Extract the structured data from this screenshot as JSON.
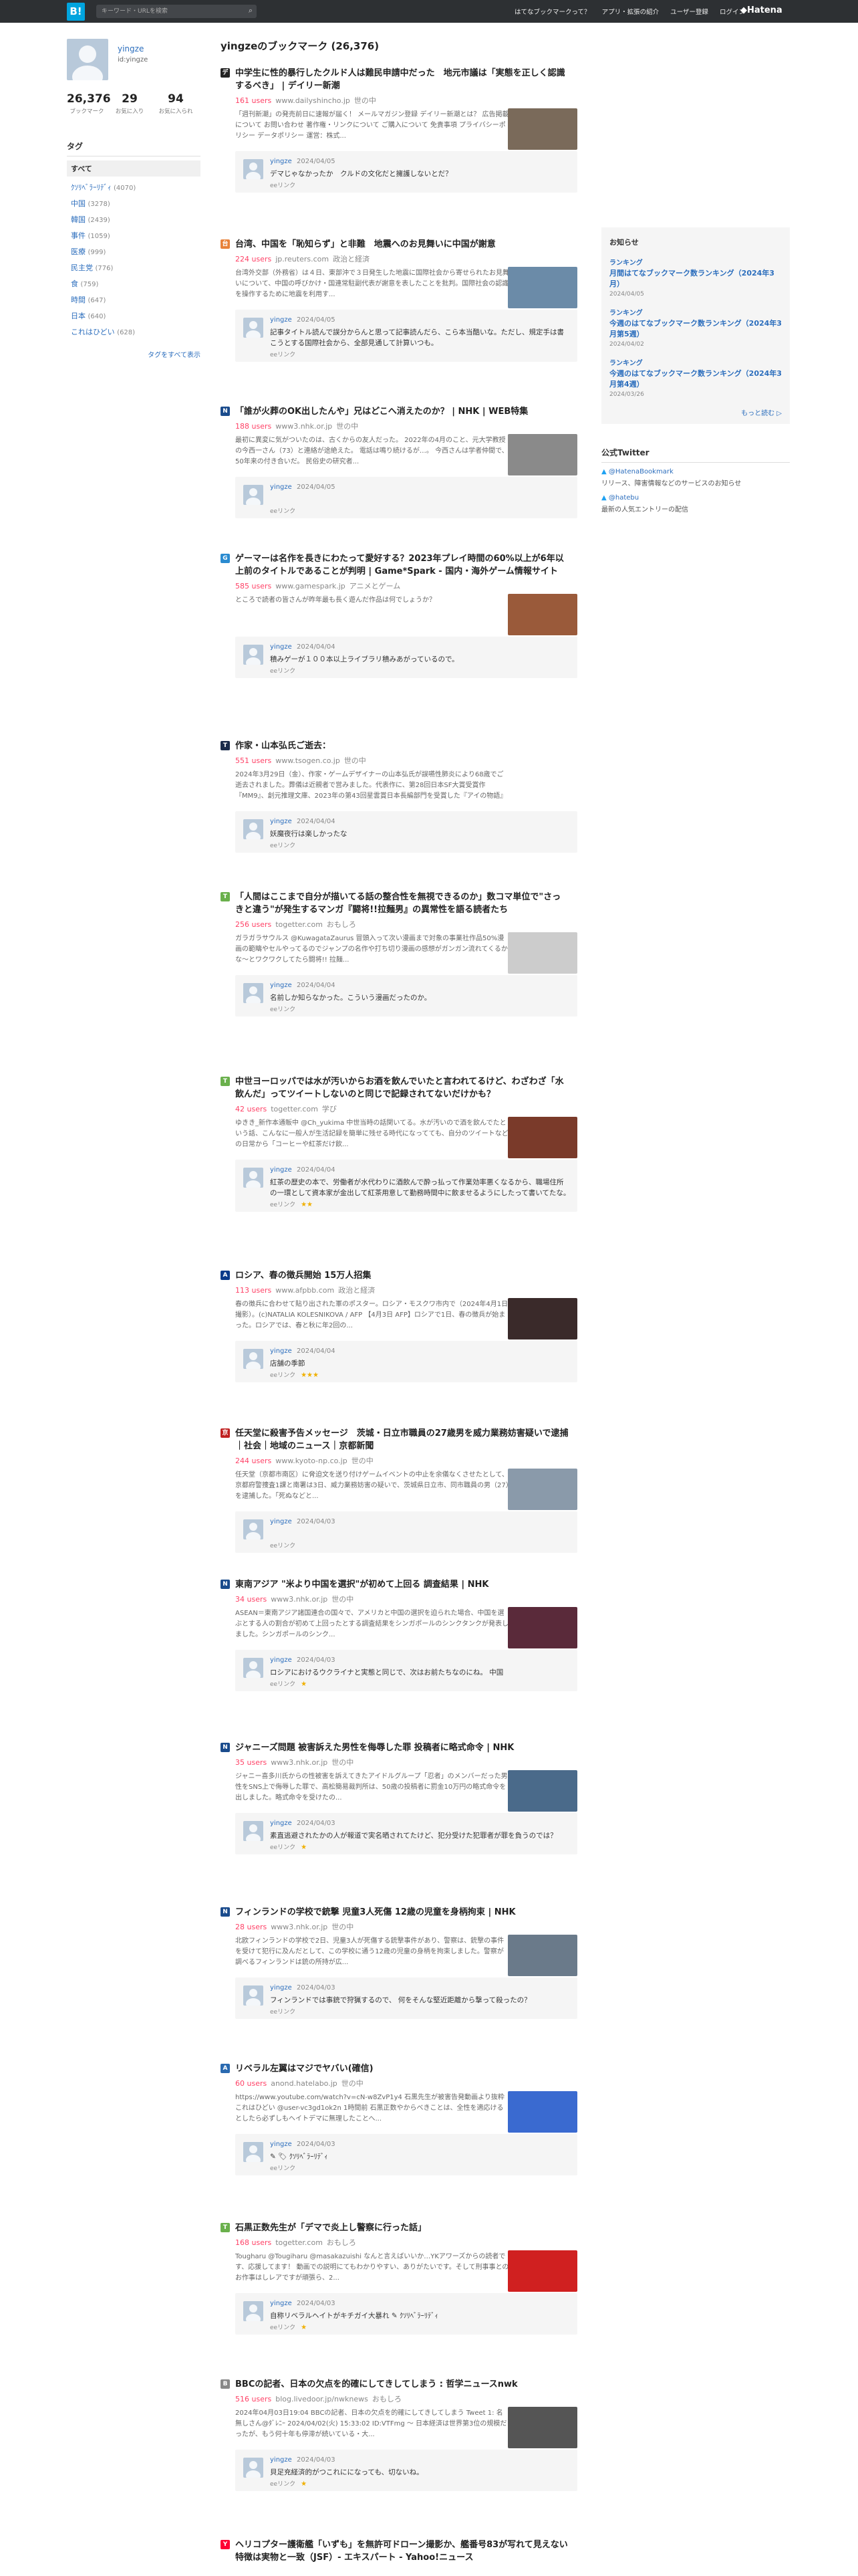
{
  "header": {
    "logo": "B!",
    "search_placeholder": "キーワード・URLを検索",
    "nav": [
      "はてなブックマークって？",
      "アプリ・拡張の紹介",
      "ユーザー登録",
      "ログイン"
    ],
    "brand": "◆Hatena"
  },
  "profile": {
    "name": "yingze",
    "id": "id:yingze",
    "stats": [
      {
        "n": "26,376",
        "l": "ブックマーク"
      },
      {
        "n": "29",
        "l": "お気に入り"
      },
      {
        "n": "94",
        "l": "お気に入られ"
      }
    ]
  },
  "tags": {
    "heading": "タグ",
    "all": "すべて",
    "items": [
      {
        "name": "ｸｿﾘﾍﾞﾗｰﾘﾃﾞｨ",
        "count": "(4070)"
      },
      {
        "name": "中国",
        "count": "(3278)"
      },
      {
        "name": "韓国",
        "count": "(2439)"
      },
      {
        "name": "事件",
        "count": "(1059)"
      },
      {
        "name": "医療",
        "count": "(999)"
      },
      {
        "name": "民主党",
        "count": "(776)"
      },
      {
        "name": "食",
        "count": "(759)"
      },
      {
        "name": "時間",
        "count": "(647)"
      },
      {
        "name": "日本",
        "count": "(640)"
      },
      {
        "name": "これはひどい",
        "count": "(628)"
      }
    ],
    "more": "タグをすべて表示"
  },
  "main": {
    "title": "yingzeのブックマーク (26,376)",
    "entries": [
      {
        "fav": "デ",
        "favcolor": "#222",
        "title": "中学生に性的暴行したクルド人は難民申請中だった　地元市議は「実態を正しく認識するべき」 | デイリー新潮",
        "users": "161 users",
        "domain": "www.dailyshincho.jp",
        "cat": "世の中",
        "body": "「週刊新潮」の発売前日に速報が届く！ メールマガジン登録 デイリー新潮とは？ 広告掲載について お問い合わせ 著作権・リンクについて ご購入について 免責事項 プライバシーポリシー データポリシー 運営：株式...",
        "user": "yingze",
        "date": "2024/04/05",
        "comment": "デマじゃなかったか　クルドの文化だと擁護しないとだ？",
        "foot": "eeリンク",
        "stars": "",
        "thumb": "#7a6a5a"
      },
      {
        "fav": "台",
        "favcolor": "#e8823a",
        "title": "台湾、中国を「恥知らず」と非難　地震へのお見舞いに中国が謝意",
        "users": "224 users",
        "domain": "jp.reuters.com",
        "cat": "政治と経済",
        "body": "台湾外交部（外務省）は４日、東部沖で３日発生した地震に国際社会から寄せられたお見舞いについて、中国の呼びかけ・国連常駐副代表が謝意を表したことを批判。国際社会の認識を操作するために地震を利用す...",
        "user": "yingze",
        "date": "2024/04/05",
        "comment": "記事タイトル読んで誤分からんと思って記事読んだら、こら本当酷いな。ただし、規定手は書こうとする国際社会から、全部見通して計算いつも。",
        "foot": "eeリンク",
        "stars": "",
        "thumb": "#6b8ba8"
      },
      {
        "fav": "N",
        "favcolor": "#1a4b8c",
        "title": "「誰が火葬のOK出したんや」兄はどこへ消えたのか？ | NHK | WEB特集",
        "users": "188 users",
        "domain": "www3.nhk.or.jp",
        "cat": "世の中",
        "body": "最初に異変に気がついたのは、古くからの友人だった。 2022年の4月のこと、元大学教授の今西一さん（73）と連絡が途絶えた。 電話は鳴り続けるが…。 今西さんは学者仲間で、50年来の付き合いだ。 民俗史の研究者...",
        "user": "yingze",
        "date": "2024/04/05",
        "comment": "",
        "foot": "eeリンク",
        "stars": "",
        "thumb": "#8a8a8a"
      },
      {
        "fav": "G",
        "favcolor": "#2a8bd0",
        "title": "ゲーマーは名作を長きにわたって愛好する？2023年プレイ時間の60%以上が6年以上前のタイトルであることが判明 | Game*Spark - 国内・海外ゲーム情報サイト",
        "users": "585 users",
        "domain": "www.gamespark.jp",
        "cat": "アニメとゲーム",
        "body": "ところで読者の皆さんが昨年最も長く遊んだ作品は何でしょうか？",
        "user": "yingze",
        "date": "2024/04/04",
        "comment": "積みゲーが１００本以上ライブラリ積みあがっているので。",
        "foot": "eeリンク",
        "stars": "",
        "thumb": "#9a5a3a"
      },
      {
        "fav": "T",
        "favcolor": "#1a2b4a",
        "title": "作家・山本弘氏ご逝去：",
        "users": "551 users",
        "domain": "www.tsogen.co.jp",
        "cat": "世の中",
        "body": "2024年3月29日（金）、作家・ゲームデザイナーの山本弘氏が誤嚥性肺炎により68歳でご逝去されました。葬儀は近親者で営みました。代表作に、第28回日本SF大賞受賞作『MM9』、創元推理文庫、2023年の第43回星雲賞日本長編部門を受賞した『アイの物語』のほか、『神は沈黙せず』、《MM9》《BISビブ...",
        "user": "yingze",
        "date": "2024/04/04",
        "comment": "妖魔夜行は楽しかったな",
        "foot": "eeリンク",
        "stars": "",
        "thumb": ""
      },
      {
        "fav": "T",
        "favcolor": "#6ab04c",
        "title": "「人間はここまで自分が描いてる話の整合性を無視できるのか」数コマ単位で\"さっきと違う\"が発生するマンガ『闘将!!拉麵男』の異常性を語る読者たち",
        "users": "256 users",
        "domain": "togetter.com",
        "cat": "おもしろ",
        "body": "ガラガラサウルス @KuwagataZaurus 冒頭入って次い漫画まで対象の事業社作品50%漫画の範疇やセルやってるのでジャンプの名作や打ち切り漫画の感想がガンガン流れてくるかな〜とワクワクしてたら闘将!! 拉麺...",
        "user": "yingze",
        "date": "2024/04/04",
        "comment": "名前しか知らなかった。こういう漫画だったのか。",
        "foot": "eeリンク",
        "stars": "",
        "thumb": "#ccc"
      },
      {
        "fav": "T",
        "favcolor": "#6ab04c",
        "title": "中世ヨーロッパでは水が汚いからお酒を飲んでいたと言われてるけど、わざわざ「水飲んだ」ってツイートしないのと同じで記録されてないだけかも？",
        "users": "42 users",
        "domain": "togetter.com",
        "cat": "学び",
        "body": "ゆきき_新作本通販中 @Ch_yukima 中世当時の話関いてる。水が汚いので酒を飲んでたという話、こんなに一般人が生活記録を簡単に残せる時代になってても、自分のツイートなどの日常から「コーヒーや紅茶だけ飲...",
        "user": "yingze",
        "date": "2024/04/04",
        "comment": "紅茶の歴史の本で、労働者が水代わりに酒飲んで酔っ払って作業効率悪くなるから、職場住所の一環として資本家が金出して紅茶用意して勤務時間中に飲ませるようにしたって書いてたな。",
        "foot": "eeリンク",
        "stars": "★★",
        "thumb": "#7a3a2a"
      },
      {
        "fav": "A",
        "favcolor": "#0a3a8a",
        "title": "ロシア、春の徴兵開始 15万人招集",
        "users": "113 users",
        "domain": "www.afpbb.com",
        "cat": "政治と経済",
        "body": "春の徴兵に合わせて貼り出された軍のポスター。ロシア・モスクワ市内で（2024年4月1日撮影）。(c)NATALIA KOLESNIKOVA / AFP 【4月3日 AFP】ロシアで1日、春の徴兵が始まった。ロシアでは、春と秋に年2回の...",
        "user": "yingze",
        "date": "2024/04/04",
        "comment": "店舗の季節",
        "foot": "eeリンク",
        "stars": "★★★",
        "thumb": "#3a2a2a"
      },
      {
        "fav": "京",
        "favcolor": "#c02020",
        "title": "任天堂に殺害予告メッセージ　茨城・日立市職員の27歳男を威力業務妨害疑いで逮捕｜社会｜地域のニュース｜京都新聞",
        "users": "244 users",
        "domain": "www.kyoto-np.co.jp",
        "cat": "世の中",
        "body": "任天堂（京都市南区）に脅迫文を送り付けゲームイベントの中止を余儀なくさせたとして、京都府警捜査1課と南署は3日、威力業務妨害の疑いで、茨城県日立市、同市職員の男（27）を逮捕した。「死ぬなどと...",
        "user": "yingze",
        "date": "2024/04/03",
        "comment": "",
        "foot": "eeリンク",
        "stars": "",
        "thumb": "#8a9aaa"
      },
      {
        "fav": "N",
        "favcolor": "#1a4b8c",
        "title": "東南アジア \"米より中国を選択\"が初めて上回る 調査結果 | NHK",
        "users": "34 users",
        "domain": "www3.nhk.or.jp",
        "cat": "世の中",
        "body": "ASEAN＝東南アジア諸国連合の国々で、アメリカと中国の選択を迫られた場合、中国を選ぶとする人の割合が初めて上回ったとする調査結果をシンガポールのシンクタンクが発表しました。シンガポールのシンク...",
        "user": "yingze",
        "date": "2024/04/03",
        "comment": "ロシアにおけるウクライナと実態と同じで、次はお前たちなのにね。 中国",
        "foot": "eeリンク",
        "stars": "★",
        "thumb": "#5a2a3a"
      },
      {
        "fav": "N",
        "favcolor": "#1a4b8c",
        "title": "ジャニーズ問題 被害訴えた男性を侮辱した罪 投稿者に略式命令 | NHK",
        "users": "35 users",
        "domain": "www3.nhk.or.jp",
        "cat": "世の中",
        "body": "ジャニー喜多川氏からの性被害を訴えてきたアイドルグループ「忍者」のメンバーだった男性をSNS上で侮辱した罪で、高松簡易裁判所は、50歳の投稿者に罰金10万円の略式命令を出しました。略式命令を受けたの...",
        "user": "yingze",
        "date": "2024/04/03",
        "comment": "素直逃避されたかの人が報道で実名晒されてたけど、犯分受けた犯罪者が罪を負うのでは？",
        "foot": "eeリンク",
        "stars": "★",
        "thumb": "#4a6a8a"
      },
      {
        "fav": "N",
        "favcolor": "#1a4b8c",
        "title": "フィンランドの学校で銃撃 児童3人死傷 12歳の児童を身柄拘束 | NHK",
        "users": "28 users",
        "domain": "www3.nhk.or.jp",
        "cat": "世の中",
        "body": "北欧フィンランドの学校で2日、児童3人が死傷する銃撃事件があり、警察は、銃撃の事件を受けて犯行に及んだとして、この学校に通う12歳の児童の身柄を拘束しました。警察が調べるフィンランドは銃の所持が広...",
        "user": "yingze",
        "date": "2024/04/03",
        "comment": "フィンランドでは事銃で狩猟するので、 何をそんな堅近距離から撃って殺ったの？",
        "foot": "eeリンク",
        "stars": "",
        "thumb": "#6a7a8a"
      },
      {
        "fav": "A",
        "favcolor": "#2a6ab0",
        "title": "リベラル左翼はマジでヤバい(確信)",
        "users": "60 users",
        "domain": "anond.hatelabo.jp",
        "cat": "世の中",
        "body": "https://www.youtube.com/watch?v=cN-w8ZvP1y4 石黒先生が被害告発動画より抜粋 これはひどい @user-vc3gd1ok2n 1時間前 石黒正数やからべきことは、全性を適応けるとしたら必ずしもヘイトデマに無理したことへ...",
        "user": "yingze",
        "date": "2024/04/03",
        "comment": "✎ 🏷 ｸｿﾘﾍﾞﾗｰﾘﾃﾞｨ",
        "foot": "eeリンク",
        "stars": "",
        "thumb": "#3a6ad0"
      },
      {
        "fav": "T",
        "favcolor": "#6ab04c",
        "title": "石黒正数先生が「デマで炎上し警察に行った話」",
        "users": "168 users",
        "domain": "togetter.com",
        "cat": "おもしろ",
        "body": "Tougharu @Tougiharu @masakazuishi なんと言えばいいか…YKアワーズからの読者です、応援してます！ 動画での説明にてもわかりやすい、ありがたいです。そして刑事事とのお作事はしレアですが頑張ら、2...",
        "user": "yingze",
        "date": "2024/04/03",
        "comment": "自称リベラルヘイトがキチガイ大暴れ ✎ ｸｿﾘﾍﾞﾗｰﾘﾃﾞｨ",
        "foot": "eeリンク",
        "stars": "★",
        "thumb": "#d02020"
      },
      {
        "fav": "B",
        "favcolor": "#888",
        "title": "BBCの記者、日本の欠点を的確にしてきしてしまう : 哲学ニュースnwk",
        "users": "516 users",
        "domain": "blog.livedoor.jp/nwknews",
        "cat": "おもしろ",
        "body": "2024年04月03日19:04 BBCの記者、日本の欠点を的確にしてきしてしまう Tweet 1: 名無しさん@ﾀﾞﾚﾆｰ 2024/04/02(火) 15:33:02 ID:VTFmg ～ 日本経済は世界第3位の規模だったが、もう何十年も停滞が続いている・大...",
        "user": "yingze",
        "date": "2024/04/03",
        "comment": "貝足充経済的がつこれにになっても、切ないね。",
        "foot": "eeリンク",
        "stars": "★",
        "thumb": "#555"
      },
      {
        "fav": "Y",
        "favcolor": "#ff0033",
        "title": "ヘリコプター護衛艦「いずも」を無許可ドローン撮影か、艦番号83が写れて見えない特徴は実物と一致（JSF）- エキスパート - Yahoo!ニュース",
        "users": "",
        "domain": "",
        "cat": "",
        "body": "",
        "user": "",
        "date": "",
        "comment": "",
        "foot": "",
        "stars": "",
        "thumb": ""
      }
    ]
  },
  "side": {
    "notice_heading": "お知らせ",
    "notices": [
      {
        "cat": "ランキング",
        "title": "月間はてなブックマーク数ランキング（2024年3月）",
        "date": "2024/04/05"
      },
      {
        "cat": "ランキング",
        "title": "今週のはてなブックマーク数ランキング（2024年3月第5週）",
        "date": "2024/04/02"
      },
      {
        "cat": "ランキング",
        "title": "今週のはてなブックマーク数ランキング（2024年3月第4週）",
        "date": "2024/03/26"
      }
    ],
    "notice_more": "もっと読む ▷",
    "twitter_heading": "公式Twitter",
    "twitter": [
      {
        "account": "@HatenaBookmark",
        "desc": "リリース、障害情報などのサービスのお知らせ"
      },
      {
        "account": "@hatebu",
        "desc": "最新の人気エントリーの配信"
      }
    ]
  }
}
